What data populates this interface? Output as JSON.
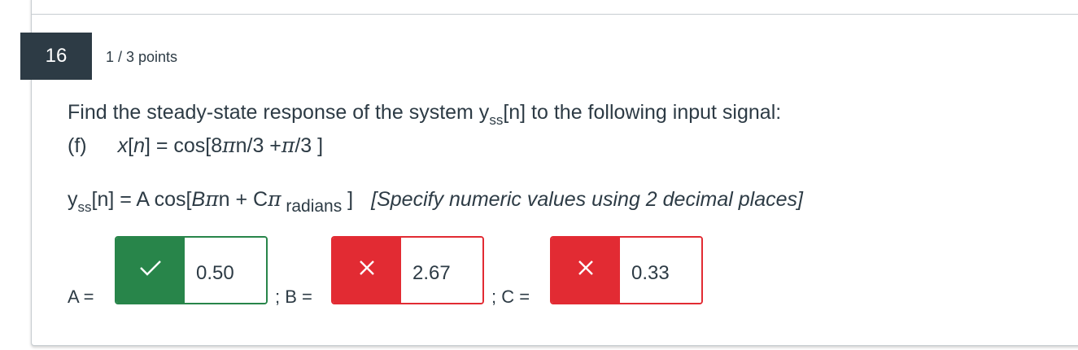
{
  "question": {
    "number": "16",
    "points": "1 / 3 points",
    "prompt_line1_a": "Find the steady-state response of the system y",
    "prompt_line1_sub": "ss",
    "prompt_line1_b": "[n] to the following input signal:",
    "part_label": "(f)",
    "signal_x": "x",
    "signal_bracket_n": "[",
    "signal_n": "n",
    "signal_eq": "] = cos[8",
    "signal_pi": "π",
    "signal_mid": "n/3 +",
    "signal_pi2": "π",
    "signal_end": "/3 ]",
    "formula_y": "y",
    "formula_sub": "ss",
    "formula_a": "[n] = A cos[",
    "formula_B": "B",
    "formula_pi": "π",
    "formula_b": "n + C",
    "formula_pi2": "π",
    "formula_radians": " radians",
    "formula_close": " ]",
    "instruction": "[Specify numeric values using 2 decimal places]"
  },
  "answers": {
    "A": {
      "label": "A =",
      "value": "0.50",
      "status": "correct",
      "status_icon": "check-icon"
    },
    "B": {
      "label": "; B =",
      "value": "2.67",
      "status": "incorrect",
      "status_icon": "x-icon"
    },
    "C": {
      "label": "; C =",
      "value": "0.33",
      "status": "incorrect",
      "status_icon": "x-icon"
    }
  },
  "colors": {
    "correct": "#28854a",
    "incorrect": "#e22b33",
    "number_badge": "#2d3b45",
    "text": "#2d3b45"
  }
}
